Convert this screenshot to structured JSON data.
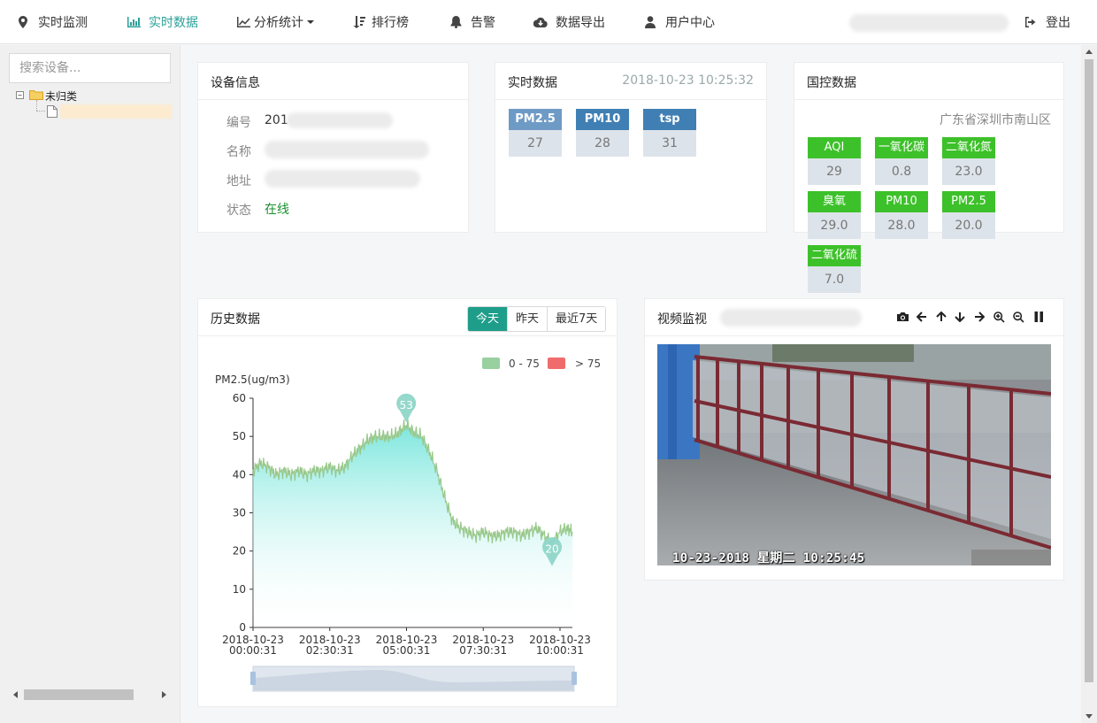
{
  "nav": {
    "items": [
      {
        "label": "实时监测",
        "icon": "map-marker-icon"
      },
      {
        "label": "实时数据",
        "icon": "bar-chart-icon"
      },
      {
        "label": "分析统计",
        "icon": "line-chart-icon"
      },
      {
        "label": "排行榜",
        "icon": "sort-icon"
      },
      {
        "label": "告警",
        "icon": "bell-icon"
      },
      {
        "label": "数据导出",
        "icon": "cloud-download-icon"
      },
      {
        "label": "用户中心",
        "icon": "user-icon"
      }
    ],
    "logout": "登出"
  },
  "sidebar": {
    "search_placeholder": "搜索设备...",
    "tree": {
      "toggle": "−",
      "folder_label": "未归类"
    }
  },
  "device_info": {
    "title": "设备信息",
    "fields": [
      {
        "key": "编号",
        "value": "201"
      },
      {
        "key": "名称",
        "value": ""
      },
      {
        "key": "地址",
        "value": ""
      },
      {
        "key": "状态",
        "value": "在线"
      }
    ]
  },
  "realtime": {
    "title": "实时数据",
    "timestamp": "2018-10-23 10:25:32",
    "tags": [
      {
        "label": "PM2.5",
        "value": "27",
        "color": "#6e9bc6"
      },
      {
        "label": "PM10",
        "value": "28",
        "color": "#3f7fb4"
      },
      {
        "label": "tsp",
        "value": "31",
        "color": "#3f7fb4"
      }
    ]
  },
  "national": {
    "title": "国控数据",
    "location": "广东省深圳市南山区",
    "tags": [
      {
        "label": "AQI",
        "value": "29"
      },
      {
        "label": "一氧化碳",
        "value": "0.8"
      },
      {
        "label": "二氧化氮",
        "value": "23.0"
      },
      {
        "label": "臭氧",
        "value": "29.0"
      },
      {
        "label": "PM10",
        "value": "28.0"
      },
      {
        "label": "PM2.5",
        "value": "20.0"
      },
      {
        "label": "二氧化硫",
        "value": "7.0"
      }
    ],
    "tag_color": "#3dc12a"
  },
  "history": {
    "title": "历史数据",
    "ranges": [
      "今天",
      "昨天",
      "最近7天"
    ],
    "active_range": "今天",
    "legend": [
      {
        "label": "0 - 75",
        "color": "#98d0a0"
      },
      {
        "label": "> 75",
        "color": "#f06c6c"
      }
    ]
  },
  "chart_data": {
    "type": "area",
    "ylabel": "PM2.5(ug/m3)",
    "ylim": [
      0,
      60
    ],
    "yticks": [
      0,
      10,
      20,
      30,
      40,
      50,
      60
    ],
    "xticks": [
      {
        "date": "2018-10-23",
        "time": "00:00:31"
      },
      {
        "date": "2018-10-23",
        "time": "02:30:31"
      },
      {
        "date": "2018-10-23",
        "time": "05:00:31"
      },
      {
        "date": "2018-10-23",
        "time": "07:30:31"
      },
      {
        "date": "2018-10-23",
        "time": "10:00:31"
      }
    ],
    "series": [
      {
        "x": [
          "00:00",
          "00:15",
          "00:30",
          "00:45",
          "01:00",
          "01:15",
          "01:30",
          "01:45",
          "02:00",
          "02:15",
          "02:30",
          "02:45",
          "03:00",
          "03:15",
          "03:30",
          "03:45",
          "04:00",
          "04:15",
          "04:30",
          "04:45",
          "05:00",
          "05:15",
          "05:30",
          "05:45",
          "06:00",
          "06:15",
          "06:30",
          "06:45",
          "07:00",
          "07:15",
          "07:30",
          "07:45",
          "08:00",
          "08:15",
          "08:30",
          "08:45",
          "09:00",
          "09:15",
          "09:30",
          "09:45",
          "10:00",
          "10:15",
          "10:25"
        ],
        "values": [
          41,
          43,
          42,
          40,
          41,
          40,
          41,
          40,
          41,
          41,
          42,
          41,
          42,
          45,
          47,
          49,
          50,
          50,
          50,
          51,
          53,
          51,
          50,
          46,
          41,
          34,
          28,
          26,
          25,
          24,
          25,
          24,
          24,
          25,
          25,
          24,
          25,
          26,
          24,
          22,
          25,
          26,
          25
        ]
      }
    ],
    "markers": [
      {
        "label": "53",
        "kind": "max",
        "value": 53
      },
      {
        "label": "20",
        "kind": "min",
        "value": 20
      }
    ],
    "colors": {
      "line": "#98c88a",
      "area_top": "#6ee4da",
      "marker": "#8fd6c9"
    }
  },
  "video": {
    "title": "视频监视",
    "timestamp": "10-23-2018 星期二 10:25:45",
    "tools": [
      "camera-icon",
      "arrow-left-icon",
      "arrow-up-icon",
      "arrow-down-icon",
      "arrow-right-icon",
      "zoom-in-icon",
      "zoom-out-icon",
      "pause-icon"
    ]
  }
}
